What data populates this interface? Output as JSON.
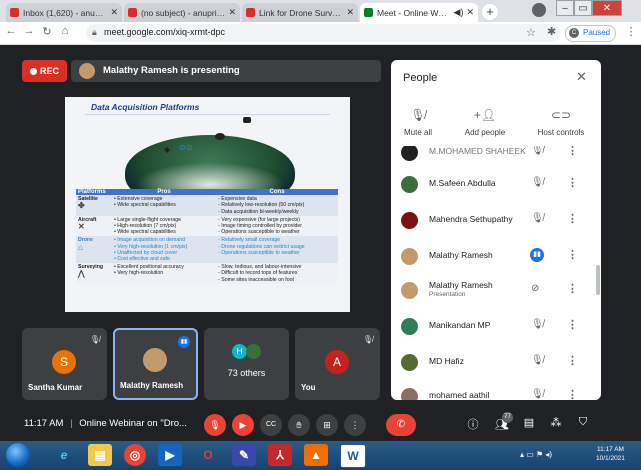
{
  "browser": {
    "tabs": [
      {
        "title": "Inbox (1,620) - anupriya@...",
        "icon_color": "#d93025",
        "active": false
      },
      {
        "title": "(no subject) - anupriyam...",
        "icon_color": "#d93025",
        "active": false
      },
      {
        "title": "Link for Drone Surveying...",
        "icon_color": "#d93025",
        "active": false
      },
      {
        "title": "Meet - Online Webi...",
        "icon_color": "#00832d",
        "active": true
      }
    ],
    "new_tab": "+",
    "url": "meet.google.com/xiq-xrmt-dpc",
    "profile_status": "Paused"
  },
  "meet": {
    "rec_label": "REC",
    "presenting_text": "Malathy Ramesh is presenting",
    "slide": {
      "title": "Data Acquisition Platforms",
      "columns": [
        "Platforms",
        "Pros",
        "Cons"
      ],
      "rows": [
        {
          "platform": "Satellite",
          "pros": "• Extensive coverage\n• Wide spectral capabilities",
          "cons": "- Expensive data\n- Relatively low-resolution (50 cm/pix)\n- Data acquisition bi-weekly/weekly"
        },
        {
          "platform": "Aircraft",
          "pros": "• Large single-flight coverage\n• High-resolution (7 cm/pix)\n• Wide spectral capabilities",
          "cons": "- Very expensive (for large projects)\n- Image timing controlled by provider\n- Operations susceptible to weather"
        },
        {
          "platform": "Drone",
          "pros": "• Image acquisition on demand\n• Very high-resolution (1 cm/pix)\n• Unaffected by cloud cover\n• Cost effective and safe",
          "cons": "- Relatively small coverage\n- Drone regulations can restrict usage\n- Operations susceptible to weather"
        },
        {
          "platform": "Surveying",
          "pros": "• Excellent positional accuracy\n• Very high-resolution",
          "cons": "- Slow, tedious, and labour-intensive\n- Difficult to record tops of features\n- Some sites inaccessible on foot"
        }
      ]
    },
    "tiles": [
      {
        "name": "Santha Kumar",
        "initial": "S",
        "color": "#e8710a"
      },
      {
        "name": "Malathy Ramesh",
        "initial": "",
        "color": "#c39a6b"
      },
      {
        "name": "73 others",
        "initial": "H",
        "color": "#12b5cb"
      },
      {
        "name": "You",
        "initial": "A",
        "color": "#c5221f"
      }
    ],
    "clock": "11:17 AM",
    "meeting_title": "Online Webinar on \"Dro...",
    "people_count": "77"
  },
  "people": {
    "title": "People",
    "actions": [
      {
        "label": "Mute all",
        "icon": "mic-off-icon"
      },
      {
        "label": "Add people",
        "icon": "add-person-icon"
      },
      {
        "label": "Host controls",
        "icon": "toggle-icon"
      }
    ],
    "list": [
      {
        "name": "M.MOHAMED SHAHEEK",
        "sub": "",
        "color": "#222"
      },
      {
        "name": "M.Safeen Abdulla",
        "sub": "",
        "color": "#3b6e3b"
      },
      {
        "name": "Mahendra Sethupathy",
        "sub": "",
        "color": "#7a1010"
      },
      {
        "name": "Malathy Ramesh",
        "sub": "",
        "color": "#c39a6b",
        "speaking": true
      },
      {
        "name": "Malathy Ramesh",
        "sub": "Presentation",
        "color": "#c39a6b"
      },
      {
        "name": "Manikandan MP",
        "sub": "",
        "color": "#2e7d5b"
      },
      {
        "name": "MD Hafiz",
        "sub": "",
        "color": "#556b2f"
      },
      {
        "name": "mohamed aathil",
        "sub": "",
        "color": "#8d6e63"
      }
    ]
  },
  "taskbar": {
    "time": "11:17 AM",
    "date": "10/1/2021"
  }
}
